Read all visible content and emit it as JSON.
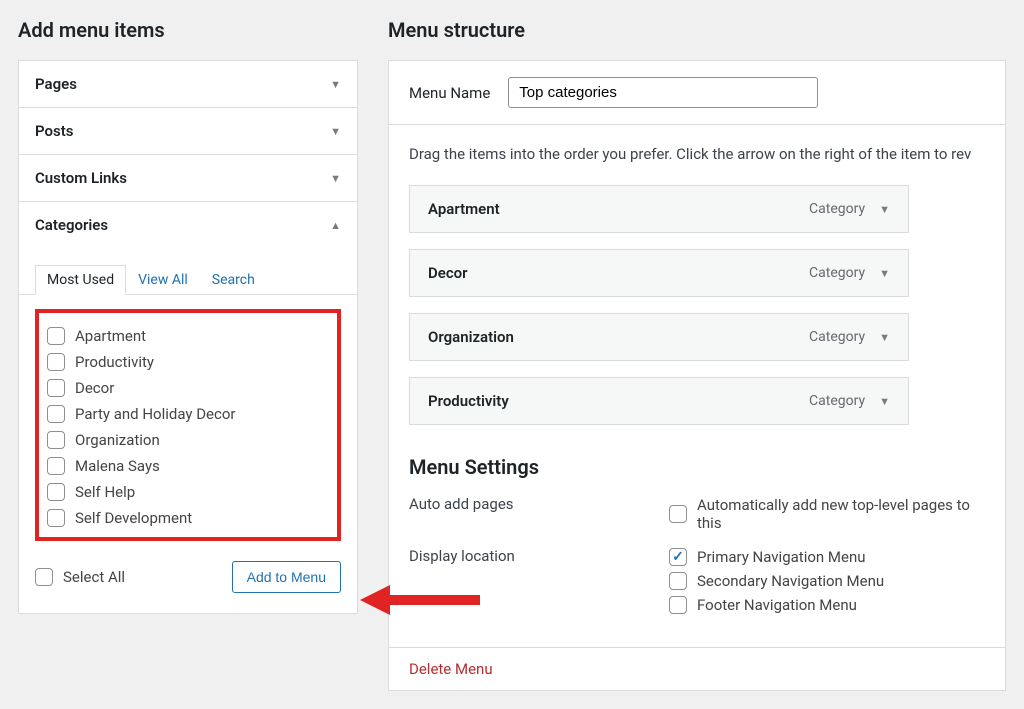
{
  "left": {
    "heading": "Add menu items",
    "panels": [
      {
        "title": "Pages",
        "open": false
      },
      {
        "title": "Posts",
        "open": false
      },
      {
        "title": "Custom Links",
        "open": false
      },
      {
        "title": "Categories",
        "open": true
      }
    ],
    "tabs": {
      "most_used": "Most Used",
      "view_all": "View All",
      "search": "Search"
    },
    "categories": [
      "Apartment",
      "Productivity",
      "Decor",
      "Party and Holiday Decor",
      "Organization",
      "Malena Says",
      "Self Help",
      "Self Development"
    ],
    "select_all": "Select All",
    "add_button": "Add to Menu"
  },
  "right": {
    "heading": "Menu structure",
    "menu_name_label": "Menu Name",
    "menu_name_value": "Top categories",
    "instructions": "Drag the items into the order you prefer. Click the arrow on the right of the item to rev",
    "items": [
      {
        "label": "Apartment",
        "type": "Category"
      },
      {
        "label": "Decor",
        "type": "Category"
      },
      {
        "label": "Organization",
        "type": "Category"
      },
      {
        "label": "Productivity",
        "type": "Category"
      }
    ],
    "settings_heading": "Menu Settings",
    "auto_add_label": "Auto add pages",
    "auto_add_option": "Automatically add new top-level pages to this",
    "display_loc_label": "Display location",
    "display_options": [
      {
        "label": "Primary Navigation Menu",
        "checked": true
      },
      {
        "label": "Secondary Navigation Menu",
        "checked": false
      },
      {
        "label": "Footer Navigation Menu",
        "checked": false
      }
    ],
    "delete_link": "Delete Menu"
  }
}
